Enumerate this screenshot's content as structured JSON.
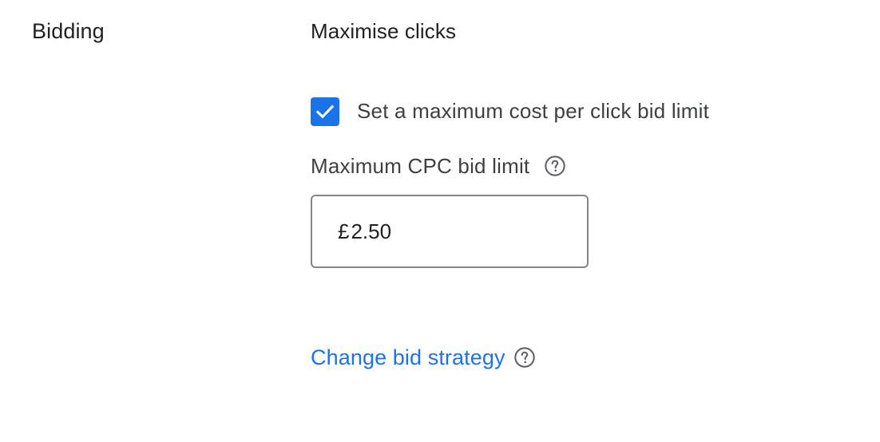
{
  "section": {
    "title": "Bidding"
  },
  "strategy": {
    "name": "Maximise clicks"
  },
  "max_cpc_checkbox": {
    "label": "Set a maximum cost per click bid limit",
    "checked": true,
    "icon": "check-icon"
  },
  "max_cpc_field": {
    "label": "Maximum CPC bid limit",
    "help_icon": "help-circle-icon",
    "currency_symbol": "£",
    "value": "2.50"
  },
  "change_strategy": {
    "label": "Change bid strategy",
    "help_icon": "help-circle-icon"
  },
  "colors": {
    "accent": "#1a73e8",
    "text_primary": "#202124",
    "text_secondary": "#3c4043",
    "border": "#80868b",
    "icon_gray": "#5f6368"
  }
}
